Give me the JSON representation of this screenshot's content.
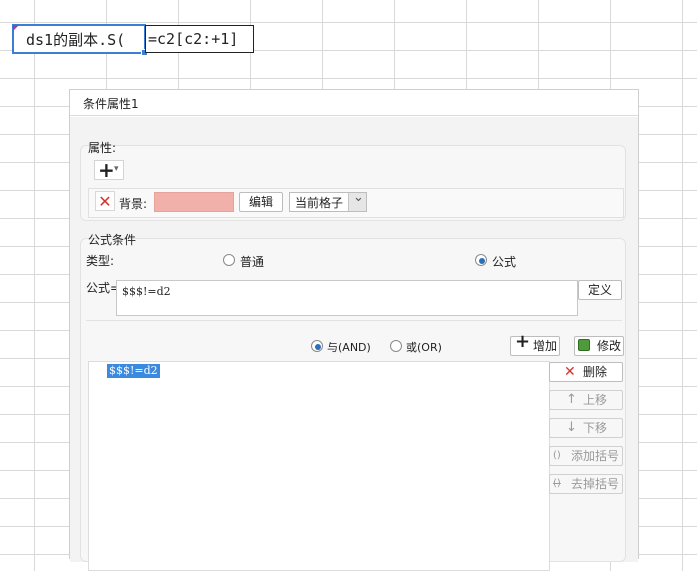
{
  "sheet": {
    "cell_a_text": "ds1的副本.S(",
    "cell_b_text": "=c2[c2:+1]"
  },
  "dialog": {
    "title": "条件属性1",
    "attributes": {
      "section_label": "属性:",
      "add_icon_glyph": "+",
      "dropdown_glyph": "▾",
      "delete_icon_glyph": "✕",
      "background_label": "背景:",
      "background_color": "#f1b0aa",
      "edit_button": "编辑",
      "scope_value": "当前格子",
      "scope_arrow": "⌄"
    },
    "formula_condition": {
      "section_label": "公式条件",
      "type_label": "类型:",
      "type_options": [
        "普通",
        "公式"
      ],
      "type_selected": "公式",
      "formula_label": "公式=",
      "formula_value": "$$$!=d2",
      "define_button": "定义",
      "logic_options": [
        "与(AND)",
        "或(OR)"
      ],
      "logic_selected": "与(AND)",
      "add_button": "增加",
      "add_glyph": "+",
      "modify_button": "修改",
      "conditions": [
        "$$$!=d2"
      ],
      "delete_button": "删除",
      "delete_glyph": "✕",
      "move_up_button": "上移",
      "move_up_glyph": "↑",
      "move_down_button": "下移",
      "move_down_glyph": "↓",
      "add_bracket_button": "添加括号",
      "add_bracket_glyph": "()",
      "remove_bracket_button": "去掉括号",
      "remove_bracket_glyph": "()"
    }
  },
  "colors": {
    "selection_blue": "#3b7fd4",
    "delete_red": "#d9322b",
    "radio_dot": "#2d6fb8",
    "list_highlight": "#3a8be0"
  }
}
